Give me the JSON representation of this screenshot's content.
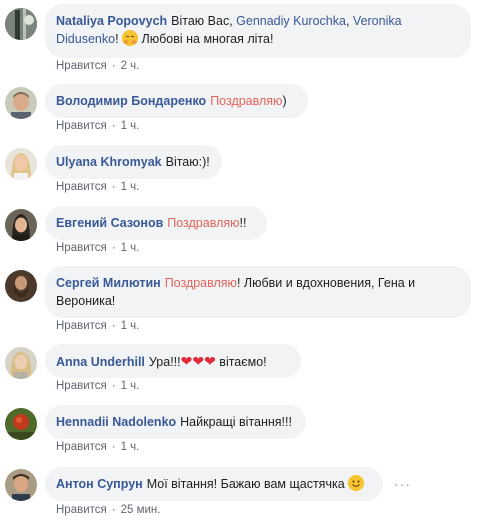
{
  "comments": [
    {
      "author": "Nataliya Popovych",
      "parts": [
        "Вітаю Вас,",
        "Gennadiy Kurochka",
        ",",
        "Veronika",
        "Didusenko",
        "!",
        "Любові на многая літа!"
      ],
      "like": "Нравится",
      "time": "2 ч."
    },
    {
      "author": "Володимир Бондаренко",
      "text_hl": "Поздравляю",
      "text_after": ")",
      "like": "Нравится",
      "time": "1 ч."
    },
    {
      "author": "Ulyana Khromyak",
      "text": "Вітаю:)!",
      "like": "Нравится",
      "time": "1 ч."
    },
    {
      "author": "Евгений Сазонов",
      "text_hl": "Поздравляю",
      "text_after": "!!",
      "like": "Нравится",
      "time": "1 ч."
    },
    {
      "author": "Сергей Милютин",
      "text_hl": "Поздравляю",
      "text_after": "! Любви и вдохновения, Гена и",
      "text_line2": "Вероника!",
      "like": "Нравится",
      "time": "1 ч."
    },
    {
      "author": "Anna Underhill",
      "text": "Ура!!!",
      "text_after": "вітаємо!",
      "like": "Нравится",
      "time": "1 ч."
    },
    {
      "author": "Hennadii Nadolenko",
      "text": "Найкращі вітання!!!",
      "like": "Нравится",
      "time": "1 ч."
    },
    {
      "author": "Антон Супрун",
      "text": "Мої вітання! Бажаю вам щастячка",
      "like": "Нравится",
      "time": "25 мин."
    }
  ],
  "more_icon": "more-horizontal-icon",
  "colors": {
    "author": "#385898",
    "highlight": "#e2645a",
    "bubble": "#f2f3f5",
    "meta": "#606770"
  }
}
